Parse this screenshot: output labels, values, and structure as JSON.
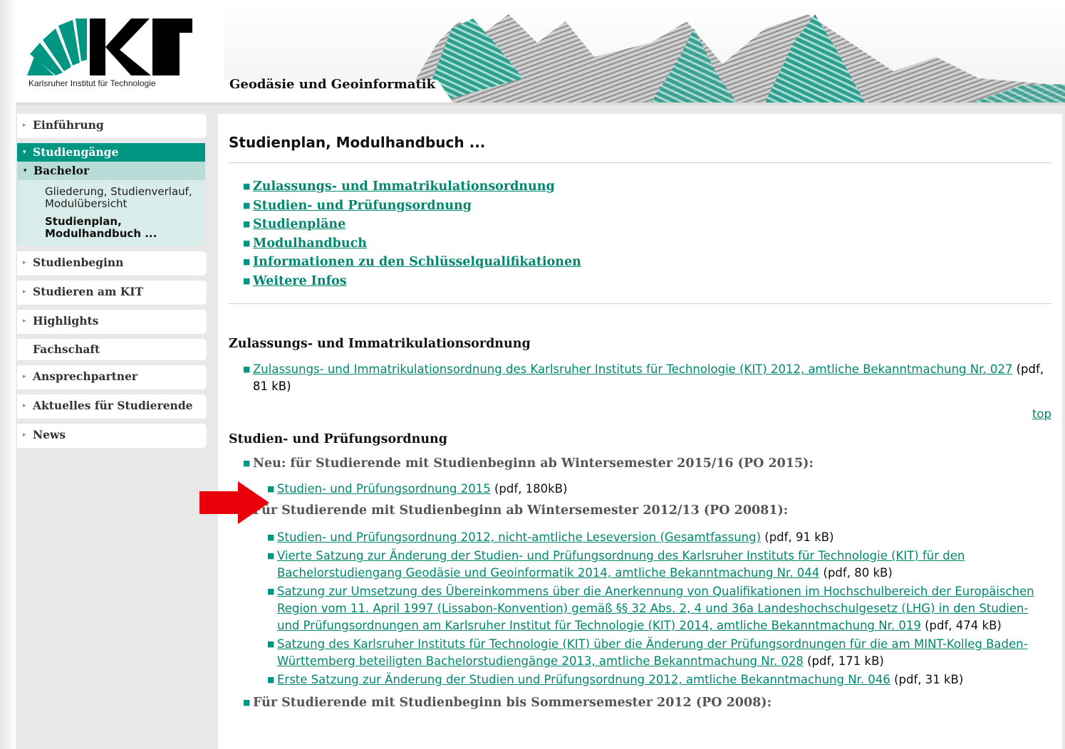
{
  "header": {
    "logo_text": "KIT",
    "logo_subtitle": "Karlsruher Institut für Technologie",
    "site_title": "Geodäsie und Geoinformatik"
  },
  "sidebar": {
    "items_before": [
      {
        "label": "Einführung",
        "arrow": true
      }
    ],
    "active": {
      "label": "Studiengänge"
    },
    "sub": {
      "head": "Bachelor",
      "links": [
        {
          "label": "Gliederung, Studienverlauf, Modulübersicht",
          "current": false
        },
        {
          "label": "Studienplan, Modulhandbuch ...",
          "current": true
        }
      ]
    },
    "items_after": [
      {
        "label": "Studienbeginn",
        "arrow": true
      },
      {
        "label": "Studieren am KIT",
        "arrow": true
      },
      {
        "label": "Highlights",
        "arrow": true
      },
      {
        "label": "Fachschaft",
        "arrow": false
      },
      {
        "label": "Ansprechpartner",
        "arrow": true
      },
      {
        "label": "Aktuelles für Studierende",
        "arrow": true
      },
      {
        "label": "News",
        "arrow": true
      }
    ]
  },
  "main": {
    "title": "Studienplan, Modulhandbuch ...",
    "toc": [
      "Zulassungs- und Immatrikulationsordnung",
      "Studien- und Prüfungsordnung",
      "Studienpläne",
      "Modulhandbuch",
      "Informationen zu den Schlüsselqualifikationen",
      "Weitere Infos"
    ],
    "section1": {
      "title": "Zulassungs- und Immatrikulationsordnung",
      "docs": [
        {
          "link": "Zulassungs- und Immatrikulationsordnung des Karlsruher Instituts für Technologie (KIT) 2012, amtliche Bekanntmachung Nr. 027",
          "meta": "(pdf, 81 kB)"
        }
      ],
      "top_label": "top"
    },
    "section2": {
      "title": "Studien- und Prüfungsordnung",
      "groups": [
        {
          "label": "Neu: für Studierende mit Studienbeginn ab Wintersemester 2015/16 (PO 2015):",
          "docs": [
            {
              "link": "Studien- und Prüfungsordnung 2015",
              "meta": "(pdf, 180kB)"
            }
          ]
        },
        {
          "label": "Für Studierende mit Studienbeginn ab Wintersemester 2012/13 (PO 20081):",
          "docs": [
            {
              "link": "Studien- und Prüfungsordnung 2012, nicht-amtliche Leseversion (Gesamtfassung)",
              "meta": "(pdf, 91 kB)"
            },
            {
              "link": "Vierte Satzung zur Änderung der Studien- und Prüfungsordnung des Karlsruher Instituts für Technologie (KIT) für den Bachelorstudiengang Geodäsie und Geoinformatik 2014, amtliche Bekanntmachung Nr. 044",
              "meta": "(pdf, 80 kB)"
            },
            {
              "link": "Satzung zur Umsetzung des Übereinkommens über die Anerkennung von Qualifikationen im Hochschulbereich der Europäischen Region vom 11. April 1997 (Lissabon-Konvention) gemäß §§ 32 Abs. 2, 4 und 36a Landeshochschulgesetz (LHG) in den Studien- und Prüfungsordnungen am Karlsruher Institut für Technologie (KIT) 2014, amtliche Bekanntmachung Nr. 019",
              "meta": "(pdf, 474 kB)"
            },
            {
              "link": "Satzung des Karlsruher Instituts für Technologie (KIT) über die Änderung der Prüfungsordnungen für die am MINT-Kolleg Baden-Württemberg beteiligten Bachelorstudiengänge 2013, amtliche Bekanntmachung Nr. 028",
              "meta": "(pdf, 171 kB)"
            },
            {
              "link": "Erste Satzung zur Änderung der Studien und Prüfungsordnung 2012, amtliche Bekanntmachung Nr. 046",
              "meta": "(pdf, 31 kB)"
            }
          ]
        },
        {
          "label": "Für Studierende mit Studienbeginn bis Sommersemester 2012 (PO 2008):",
          "docs": []
        }
      ]
    }
  },
  "colors": {
    "kit_green": "#009682",
    "link": "#00876f",
    "annotation_arrow": "#e8000b"
  },
  "icons": {
    "nav_arrow": "triangle-right-icon",
    "nav_open": "triangle-down-icon",
    "bullet": "square-bullet-icon",
    "annotation": "red-arrow-icon"
  }
}
